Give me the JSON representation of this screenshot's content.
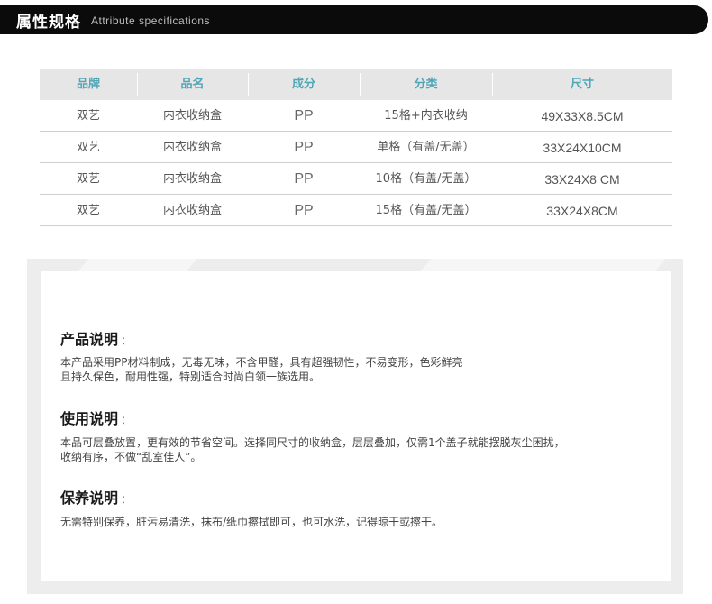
{
  "header": {
    "title": "属性规格",
    "subtitle": "Attribute specifications"
  },
  "table": {
    "headers": [
      "品牌",
      "品名",
      "成分",
      "分类",
      "尺寸"
    ],
    "rows": [
      [
        "双艺",
        "内衣收纳盒",
        "PP",
        "15格+内衣收纳",
        "49X33X8.5CM"
      ],
      [
        "双艺",
        "内衣收纳盒",
        "PP",
        "单格（有盖/无盖）",
        "33X24X10CM"
      ],
      [
        "双艺",
        "内衣收纳盒",
        "PP",
        "10格（有盖/无盖）",
        "33X24X8 CM"
      ],
      [
        "双艺",
        "内衣收纳盒",
        "PP",
        "15格（有盖/无盖）",
        "33X24X8CM"
      ]
    ]
  },
  "sections": [
    {
      "title": "产品说明",
      "colon": "：",
      "lines": [
        "本产品采用PP材料制成，无毒无味，不含甲醛，具有超强韧性，不易变形，色彩鲜亮",
        "且持久保色，耐用性强，特别适合时尚白领一族选用。"
      ]
    },
    {
      "title": "使用说明",
      "colon": "：",
      "lines": [
        "本品可层叠放置，更有效的节省空间。选择同尺寸的收纳盒，层层叠加，仅需1个盖子就能摆脱灰尘困扰，",
        "收纳有序，不做“乱室佳人”。"
      ]
    },
    {
      "title": "保养说明",
      "colon": "：",
      "lines": [
        "无需特别保养，脏污易清洗，抹布/纸巾擦拭即可，也可水洗，记得晾干或擦干。"
      ]
    }
  ],
  "colors": {
    "header_bg": "#0b0b0b",
    "table_header_text": "#4fa6b7",
    "table_header_bg": "#e6e6e6",
    "panel_bg": "#ededed"
  }
}
